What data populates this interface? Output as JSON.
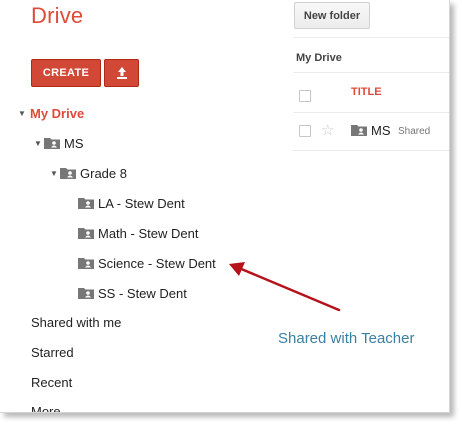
{
  "header": {
    "app_title": "Drive",
    "new_folder_label": "New folder"
  },
  "toolbar": {
    "create_label": "CREATE",
    "upload_icon": "upload-icon"
  },
  "tree": {
    "my_drive_label": "My Drive",
    "ms_label": "MS",
    "grade_label": "Grade 8",
    "children": [
      "LA - Stew Dent",
      "Math - Stew Dent",
      "Science - Stew Dent",
      "SS - Stew Dent"
    ]
  },
  "nav": {
    "shared_with_me": "Shared with me",
    "starred": "Starred",
    "recent": "Recent",
    "more": "More"
  },
  "file_panel": {
    "breadcrumb": "My Drive",
    "title_column": "TITLE",
    "rows": [
      {
        "name": "MS",
        "status": "Shared"
      }
    ]
  },
  "annotation": {
    "text": "Shared with Teacher",
    "arrow_color": "#b5121b"
  },
  "colors": {
    "brand_red": "#dd4b39",
    "button_red": "#d14836",
    "annotation_blue": "#3a7fa4"
  }
}
